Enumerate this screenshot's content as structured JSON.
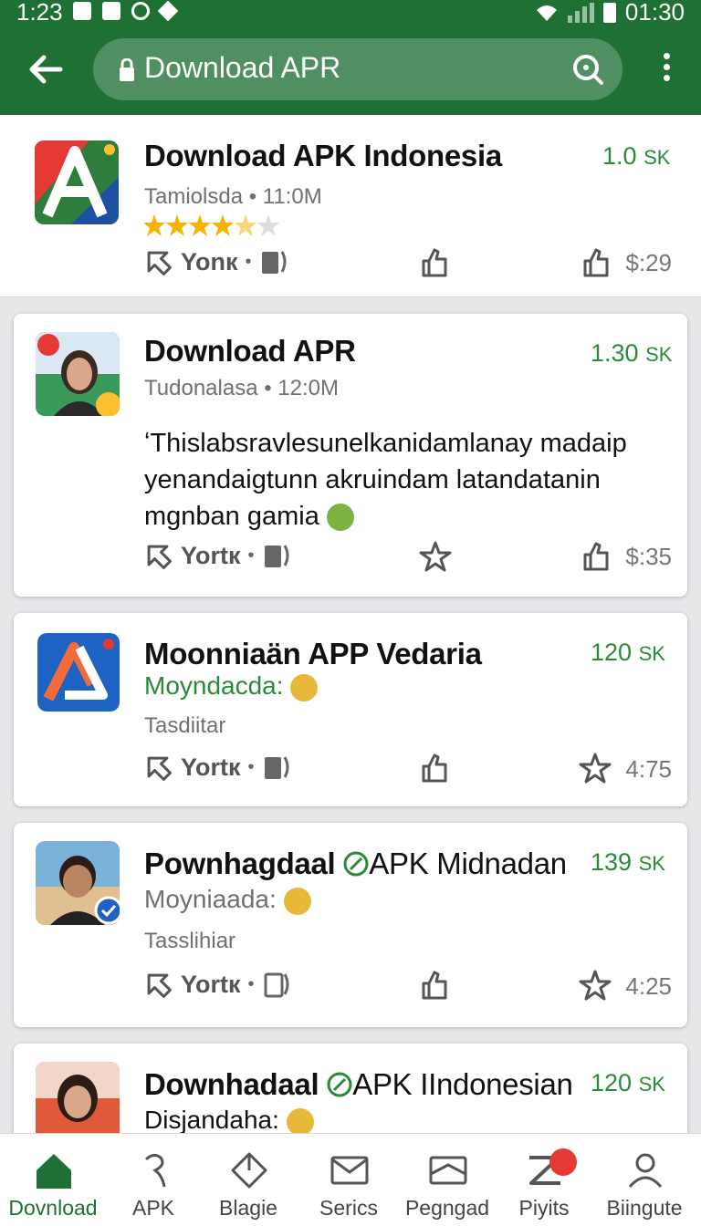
{
  "status_bar": {
    "time_left": "1:23",
    "time_right": "01:30"
  },
  "search": {
    "query": "Download APR"
  },
  "items": [
    {
      "title": "Download APK Indonesia",
      "size_num": "1.0",
      "size_unit": "SK",
      "meta": "Tamiolsda • 11:0M",
      "rating": 4.5,
      "share_label": "Yonк",
      "right_value": "$:29"
    },
    {
      "title": "Download APR",
      "size_num": "1.30",
      "size_unit": "SK",
      "meta": "Tudonalasa • 12:0M",
      "description": "ʻThislabsravlesunelkanidamlanay madaip yenandaigtunn akruindam latandatanin mgnban gamia",
      "share_label": "Yortк",
      "right_value": "$:35"
    },
    {
      "title": "Moonniaän APP Vedaria",
      "size_num": "120",
      "size_unit": "SK",
      "subtitle": "Moyndacda:",
      "meta": "Tasdiitar",
      "share_label": "Yortк",
      "right_value": "4:75"
    },
    {
      "title_part1": "Pownhagdaal",
      "title_part2": "APK Midnadan",
      "size_num": "139",
      "size_unit": "SK",
      "subtitle": "Moyniaada:",
      "meta": "Tasslihiar",
      "share_label": "Yortк",
      "right_value": "4:25"
    },
    {
      "title_part1": "Downhadaal",
      "title_part2": "APK IIndonesian",
      "size_num": "120",
      "size_unit": "SK",
      "subtitle": "Disjandaha:"
    }
  ],
  "bottom_nav": [
    {
      "label": "Dovnload",
      "icon": "home-icon",
      "active": true
    },
    {
      "label": "APK",
      "icon": "apk-icon"
    },
    {
      "label": "Blagie",
      "icon": "diamond-icon"
    },
    {
      "label": "Serics",
      "icon": "mail-icon"
    },
    {
      "label": "Pegngad",
      "icon": "inbox-icon"
    },
    {
      "label": "Piyits",
      "icon": "z-icon",
      "badge": ""
    },
    {
      "label": "Biingute",
      "icon": "person-icon"
    }
  ],
  "colors": {
    "brand_green": "#1f7035",
    "accent_green": "#2a8a3a"
  }
}
